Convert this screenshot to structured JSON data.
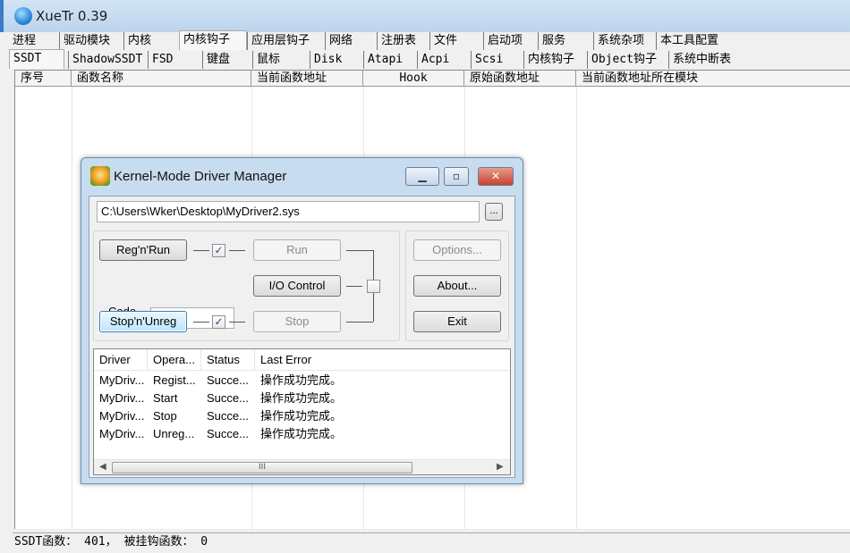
{
  "app": {
    "title": "XueTr 0.39"
  },
  "tabs_row1": [
    "进程",
    "驱动模块",
    "内核",
    "内核钩子",
    "应用层钩子",
    "网络",
    "注册表",
    "文件",
    "启动项",
    "服务",
    "系统杂项",
    "本工具配置"
  ],
  "tabs_row2": [
    "SSDT",
    "ShadowSSDT",
    "FSD",
    "键盘",
    "鼠标",
    "Disk",
    "Atapi",
    "Acpi",
    "Scsi",
    "内核钩子",
    "Object钩子",
    "系统中断表"
  ],
  "grid": {
    "columns": [
      "序号",
      "函数名称",
      "当前函数地址",
      "Hook",
      "原始函数地址",
      "当前函数地址所在模块"
    ]
  },
  "status": {
    "text": "SSDT函数： 401， 被挂钩函数： 0"
  },
  "dialog": {
    "title": "Kernel-Mode Driver Manager",
    "path": "C:\\Users\\Wker\\Desktop\\MyDriver2.sys",
    "browse_label": "...",
    "regrun_label": "Reg'n'Run",
    "run_label": "Run",
    "code_label": "Code (hex)",
    "code_value": "",
    "io_label": "I/O Control",
    "stopunreg_label": "Stop'n'Unreg",
    "stop_label": "Stop",
    "options_label": "Options...",
    "about_label": "About...",
    "exit_label": "Exit",
    "check_mark": "✓",
    "scroll_grip": "III",
    "log": {
      "columns": [
        "Driver",
        "Opera...",
        "Status",
        "Last Error"
      ],
      "rows": [
        [
          "MyDriv...",
          "Regist...",
          "Succe...",
          "操作成功完成。"
        ],
        [
          "MyDriv...",
          "Start",
          "Succe...",
          "操作成功完成。"
        ],
        [
          "MyDriv...",
          "Stop",
          "Succe...",
          "操作成功完成。"
        ],
        [
          "MyDriv...",
          "Unreg...",
          "Succe...",
          "操作成功完成。"
        ]
      ]
    }
  }
}
